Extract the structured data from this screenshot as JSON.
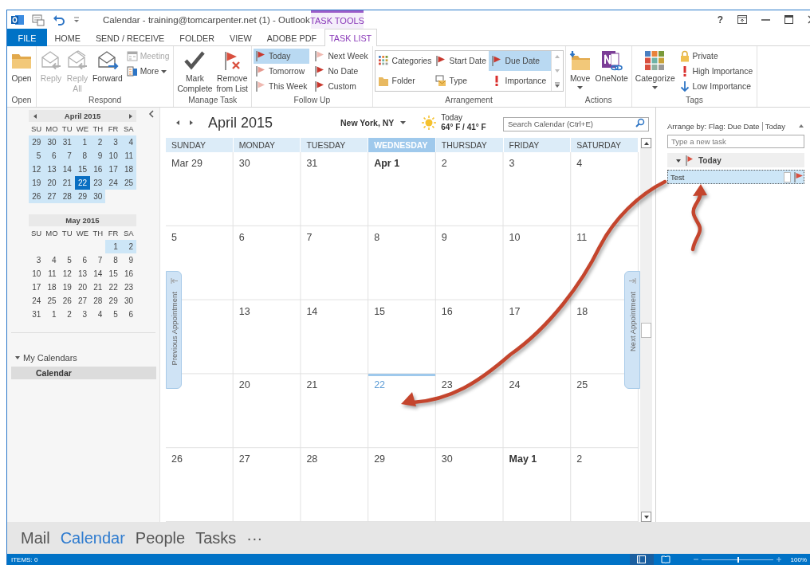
{
  "window": {
    "title": "Calendar - training@tomcarpenter.net (1) - Outlook",
    "context_tab_group": "TASK TOOLS",
    "help": "?"
  },
  "tabs": [
    {
      "label": "FILE",
      "kind": "file",
      "selected": false
    },
    {
      "label": "HOME",
      "kind": "tab",
      "selected": false
    },
    {
      "label": "SEND / RECEIVE",
      "kind": "tab",
      "selected": false
    },
    {
      "label": "FOLDER",
      "kind": "tab",
      "selected": false
    },
    {
      "label": "VIEW",
      "kind": "tab",
      "selected": false
    },
    {
      "label": "ADOBE PDF",
      "kind": "tab",
      "selected": false
    },
    {
      "label": "TASK LIST",
      "kind": "context",
      "selected": true
    }
  ],
  "ribbon": {
    "groups": [
      {
        "label": "Open",
        "buttons": [
          {
            "label": "Open",
            "kind": "large",
            "disabled": false,
            "selected": false,
            "dropdown": false
          }
        ]
      },
      {
        "label": "Respond",
        "buttons": [
          {
            "label": "Reply",
            "kind": "large",
            "disabled": true,
            "selected": false,
            "dropdown": false
          },
          {
            "label": "Reply\nAll",
            "kind": "large",
            "disabled": true,
            "selected": false,
            "dropdown": false
          },
          {
            "label": "Forward",
            "kind": "large",
            "disabled": false,
            "selected": false,
            "dropdown": false
          },
          {
            "label": "Meeting",
            "kind": "small",
            "disabled": true,
            "selected": false,
            "dropdown": false
          },
          {
            "label": "More",
            "kind": "small",
            "disabled": false,
            "selected": false,
            "dropdown": true
          }
        ]
      },
      {
        "label": "Manage Task",
        "buttons": [
          {
            "label": "Mark\nComplete",
            "kind": "large",
            "disabled": false,
            "selected": false,
            "dropdown": false
          },
          {
            "label": "Remove\nfrom List",
            "kind": "large",
            "disabled": false,
            "selected": false,
            "dropdown": false
          }
        ]
      },
      {
        "label": "Follow Up",
        "buttons": [
          {
            "label": "Today",
            "kind": "small",
            "disabled": false,
            "selected": true,
            "dropdown": false
          },
          {
            "label": "Tomorrow",
            "kind": "small",
            "disabled": false,
            "selected": false,
            "dropdown": false
          },
          {
            "label": "This Week",
            "kind": "small",
            "disabled": false,
            "selected": false,
            "dropdown": false
          },
          {
            "label": "Next Week",
            "kind": "small",
            "disabled": false,
            "selected": false,
            "dropdown": false
          },
          {
            "label": "No Date",
            "kind": "small",
            "disabled": false,
            "selected": false,
            "dropdown": false
          },
          {
            "label": "Custom",
            "kind": "small",
            "disabled": false,
            "selected": false,
            "dropdown": false
          }
        ]
      },
      {
        "label": "Arrangement",
        "buttons": [
          {
            "label": "Categories",
            "kind": "gallery",
            "disabled": false,
            "selected": false
          },
          {
            "label": "Start Date",
            "kind": "gallery",
            "disabled": false,
            "selected": false
          },
          {
            "label": "Due Date",
            "kind": "gallery",
            "disabled": false,
            "selected": true
          },
          {
            "label": "Folder",
            "kind": "gallery",
            "disabled": false,
            "selected": false
          },
          {
            "label": "Type",
            "kind": "gallery",
            "disabled": false,
            "selected": false
          },
          {
            "label": "Importance",
            "kind": "gallery",
            "disabled": false,
            "selected": false
          }
        ]
      },
      {
        "label": "Actions",
        "buttons": [
          {
            "label": "Move",
            "kind": "large",
            "disabled": false,
            "selected": false,
            "dropdown": true
          },
          {
            "label": "OneNote",
            "kind": "large",
            "disabled": false,
            "selected": false,
            "dropdown": false
          }
        ]
      },
      {
        "label": "Tags",
        "buttons": [
          {
            "label": "Categorize",
            "kind": "large",
            "disabled": false,
            "selected": false,
            "dropdown": true
          },
          {
            "label": "Private",
            "kind": "small",
            "disabled": false,
            "selected": false,
            "dropdown": false
          },
          {
            "label": "High Importance",
            "kind": "small",
            "disabled": false,
            "selected": false,
            "dropdown": false
          },
          {
            "label": "Low Importance",
            "kind": "small",
            "disabled": false,
            "selected": false,
            "dropdown": false
          }
        ]
      }
    ]
  },
  "mini_calendars": [
    {
      "title": "April 2015",
      "navigation": true,
      "weekdays": [
        "SU",
        "MO",
        "TU",
        "WE",
        "TH",
        "FR",
        "SA"
      ],
      "weeks": [
        [
          {
            "d": "29",
            "in_range": true,
            "selected": false
          },
          {
            "d": "30",
            "in_range": true,
            "selected": false
          },
          {
            "d": "31",
            "in_range": true,
            "selected": false
          },
          {
            "d": "1",
            "in_range": true,
            "selected": false
          },
          {
            "d": "2",
            "in_range": true,
            "selected": false
          },
          {
            "d": "3",
            "in_range": true,
            "selected": false
          },
          {
            "d": "4",
            "in_range": true,
            "selected": false
          }
        ],
        [
          {
            "d": "5",
            "in_range": true,
            "selected": false
          },
          {
            "d": "6",
            "in_range": true,
            "selected": false
          },
          {
            "d": "7",
            "in_range": true,
            "selected": false
          },
          {
            "d": "8",
            "in_range": true,
            "selected": false
          },
          {
            "d": "9",
            "in_range": true,
            "selected": false
          },
          {
            "d": "10",
            "in_range": true,
            "selected": false
          },
          {
            "d": "11",
            "in_range": true,
            "selected": false
          }
        ],
        [
          {
            "d": "12",
            "in_range": true,
            "selected": false
          },
          {
            "d": "13",
            "in_range": true,
            "selected": false
          },
          {
            "d": "14",
            "in_range": true,
            "selected": false
          },
          {
            "d": "15",
            "in_range": true,
            "selected": false
          },
          {
            "d": "16",
            "in_range": true,
            "selected": false
          },
          {
            "d": "17",
            "in_range": true,
            "selected": false
          },
          {
            "d": "18",
            "in_range": true,
            "selected": false
          }
        ],
        [
          {
            "d": "19",
            "in_range": true,
            "selected": false
          },
          {
            "d": "20",
            "in_range": true,
            "selected": false
          },
          {
            "d": "21",
            "in_range": true,
            "selected": false
          },
          {
            "d": "22",
            "in_range": true,
            "selected": true
          },
          {
            "d": "23",
            "in_range": true,
            "selected": false
          },
          {
            "d": "24",
            "in_range": true,
            "selected": false
          },
          {
            "d": "25",
            "in_range": true,
            "selected": false
          }
        ],
        [
          {
            "d": "26",
            "in_range": true,
            "selected": false
          },
          {
            "d": "27",
            "in_range": true,
            "selected": false
          },
          {
            "d": "28",
            "in_range": true,
            "selected": false
          },
          {
            "d": "29",
            "in_range": true,
            "selected": false
          },
          {
            "d": "30",
            "in_range": true,
            "selected": false
          }
        ]
      ]
    },
    {
      "title": "May 2015",
      "navigation": false,
      "weekdays": [
        "SU",
        "MO",
        "TU",
        "WE",
        "TH",
        "FR",
        "SA"
      ],
      "weeks": [
        [
          {
            "d": "1",
            "in_range": true,
            "selected": false
          },
          {
            "d": "2",
            "in_range": true,
            "selected": false
          }
        ],
        [
          {
            "d": "3",
            "in_range": false,
            "selected": false
          },
          {
            "d": "4",
            "in_range": false,
            "selected": false
          },
          {
            "d": "5",
            "in_range": false,
            "selected": false
          },
          {
            "d": "6",
            "in_range": false,
            "selected": false
          },
          {
            "d": "7",
            "in_range": false,
            "selected": false
          },
          {
            "d": "8",
            "in_range": false,
            "selected": false
          },
          {
            "d": "9",
            "in_range": false,
            "selected": false
          }
        ],
        [
          {
            "d": "10",
            "in_range": false,
            "selected": false
          },
          {
            "d": "11",
            "in_range": false,
            "selected": false
          },
          {
            "d": "12",
            "in_range": false,
            "selected": false
          },
          {
            "d": "13",
            "in_range": false,
            "selected": false
          },
          {
            "d": "14",
            "in_range": false,
            "selected": false
          },
          {
            "d": "15",
            "in_range": false,
            "selected": false
          },
          {
            "d": "16",
            "in_range": false,
            "selected": false
          }
        ],
        [
          {
            "d": "17",
            "in_range": false,
            "selected": false
          },
          {
            "d": "18",
            "in_range": false,
            "selected": false
          },
          {
            "d": "19",
            "in_range": false,
            "selected": false
          },
          {
            "d": "20",
            "in_range": false,
            "selected": false
          },
          {
            "d": "21",
            "in_range": false,
            "selected": false
          },
          {
            "d": "22",
            "in_range": false,
            "selected": false
          },
          {
            "d": "23",
            "in_range": false,
            "selected": false
          }
        ],
        [
          {
            "d": "24",
            "in_range": false,
            "selected": false
          },
          {
            "d": "25",
            "in_range": false,
            "selected": false
          },
          {
            "d": "26",
            "in_range": false,
            "selected": false
          },
          {
            "d": "27",
            "in_range": false,
            "selected": false
          },
          {
            "d": "28",
            "in_range": false,
            "selected": false
          },
          {
            "d": "29",
            "in_range": false,
            "selected": false
          },
          {
            "d": "30",
            "in_range": false,
            "selected": false
          }
        ],
        [
          {
            "d": "31",
            "in_range": false,
            "selected": false
          },
          {
            "d": "1",
            "in_range": false,
            "selected": false
          },
          {
            "d": "2",
            "in_range": false,
            "selected": false
          },
          {
            "d": "3",
            "in_range": false,
            "selected": false
          },
          {
            "d": "4",
            "in_range": false,
            "selected": false
          },
          {
            "d": "5",
            "in_range": false,
            "selected": false
          },
          {
            "d": "6",
            "in_range": false,
            "selected": false
          }
        ]
      ]
    }
  ],
  "folders": {
    "header": "My Calendars",
    "expanded": true,
    "items": [
      {
        "label": "Calendar",
        "selected": true
      }
    ]
  },
  "calendar": {
    "title": "April 2015",
    "location": "New York, NY",
    "weather": {
      "label": "Today",
      "temps": "64° F / 41° F"
    },
    "search_placeholder": "Search Calendar (Ctrl+E)",
    "days": [
      {
        "label": "SUNDAY",
        "selected": false
      },
      {
        "label": "MONDAY",
        "selected": false
      },
      {
        "label": "TUESDAY",
        "selected": false
      },
      {
        "label": "WEDNESDAY",
        "selected": true
      },
      {
        "label": "THURSDAY",
        "selected": false
      },
      {
        "label": "FRIDAY",
        "selected": false
      },
      {
        "label": "SATURDAY",
        "selected": false
      }
    ],
    "weeks": [
      [
        {
          "label": "Mar 29",
          "kind": "day"
        },
        {
          "label": "30",
          "kind": "day"
        },
        {
          "label": "31",
          "kind": "day"
        },
        {
          "label": "Apr 1",
          "kind": "month_start"
        },
        {
          "label": "2",
          "kind": "day"
        },
        {
          "label": "3",
          "kind": "day"
        },
        {
          "label": "4",
          "kind": "day"
        }
      ],
      [
        {
          "label": "5",
          "kind": "day"
        },
        {
          "label": "6",
          "kind": "day"
        },
        {
          "label": "7",
          "kind": "day"
        },
        {
          "label": "8",
          "kind": "day"
        },
        {
          "label": "9",
          "kind": "day"
        },
        {
          "label": "10",
          "kind": "day"
        },
        {
          "label": "11",
          "kind": "day"
        }
      ],
      [
        {
          "kind": "day"
        },
        {
          "label": "13",
          "kind": "day"
        },
        {
          "label": "14",
          "kind": "day"
        },
        {
          "label": "15",
          "kind": "day"
        },
        {
          "label": "16",
          "kind": "day"
        },
        {
          "label": "17",
          "kind": "day"
        },
        {
          "label": "18",
          "kind": "day"
        }
      ],
      [
        {
          "kind": "day"
        },
        {
          "label": "20",
          "kind": "day"
        },
        {
          "label": "21",
          "kind": "day"
        },
        {
          "label": "22",
          "kind": "today"
        },
        {
          "label": "23",
          "kind": "day"
        },
        {
          "label": "24",
          "kind": "day"
        },
        {
          "label": "25",
          "kind": "day"
        }
      ],
      [
        {
          "label": "26",
          "kind": "day"
        },
        {
          "label": "27",
          "kind": "day"
        },
        {
          "label": "28",
          "kind": "day"
        },
        {
          "label": "29",
          "kind": "day"
        },
        {
          "label": "30",
          "kind": "day"
        },
        {
          "label": "May 1",
          "kind": "month_start"
        },
        {
          "label": "2",
          "kind": "day"
        }
      ]
    ],
    "previous_appointment": "Previous Appointment",
    "next_appointment": "Next Appointment"
  },
  "task_pane": {
    "arrange_by": "Arrange by: Flag: Due Date",
    "sort": "Today",
    "new_task_placeholder": "Type a new task",
    "groups": [
      {
        "label": "Today",
        "expanded": true,
        "items": [
          {
            "subject": "Test",
            "selected": true,
            "completed": false
          }
        ]
      }
    ]
  },
  "navigation": [
    {
      "label": "Mail",
      "selected": false
    },
    {
      "label": "Calendar",
      "selected": true
    },
    {
      "label": "People",
      "selected": false
    },
    {
      "label": "Tasks",
      "selected": false
    },
    {
      "label": "···",
      "selected": false
    }
  ],
  "status_bar": {
    "items": "ITEMS: 0",
    "views": [
      {
        "kind": "normal",
        "selected": true
      },
      {
        "kind": "reading",
        "selected": false
      }
    ],
    "zoom": {
      "level": 0.5,
      "reading": "100%"
    }
  }
}
